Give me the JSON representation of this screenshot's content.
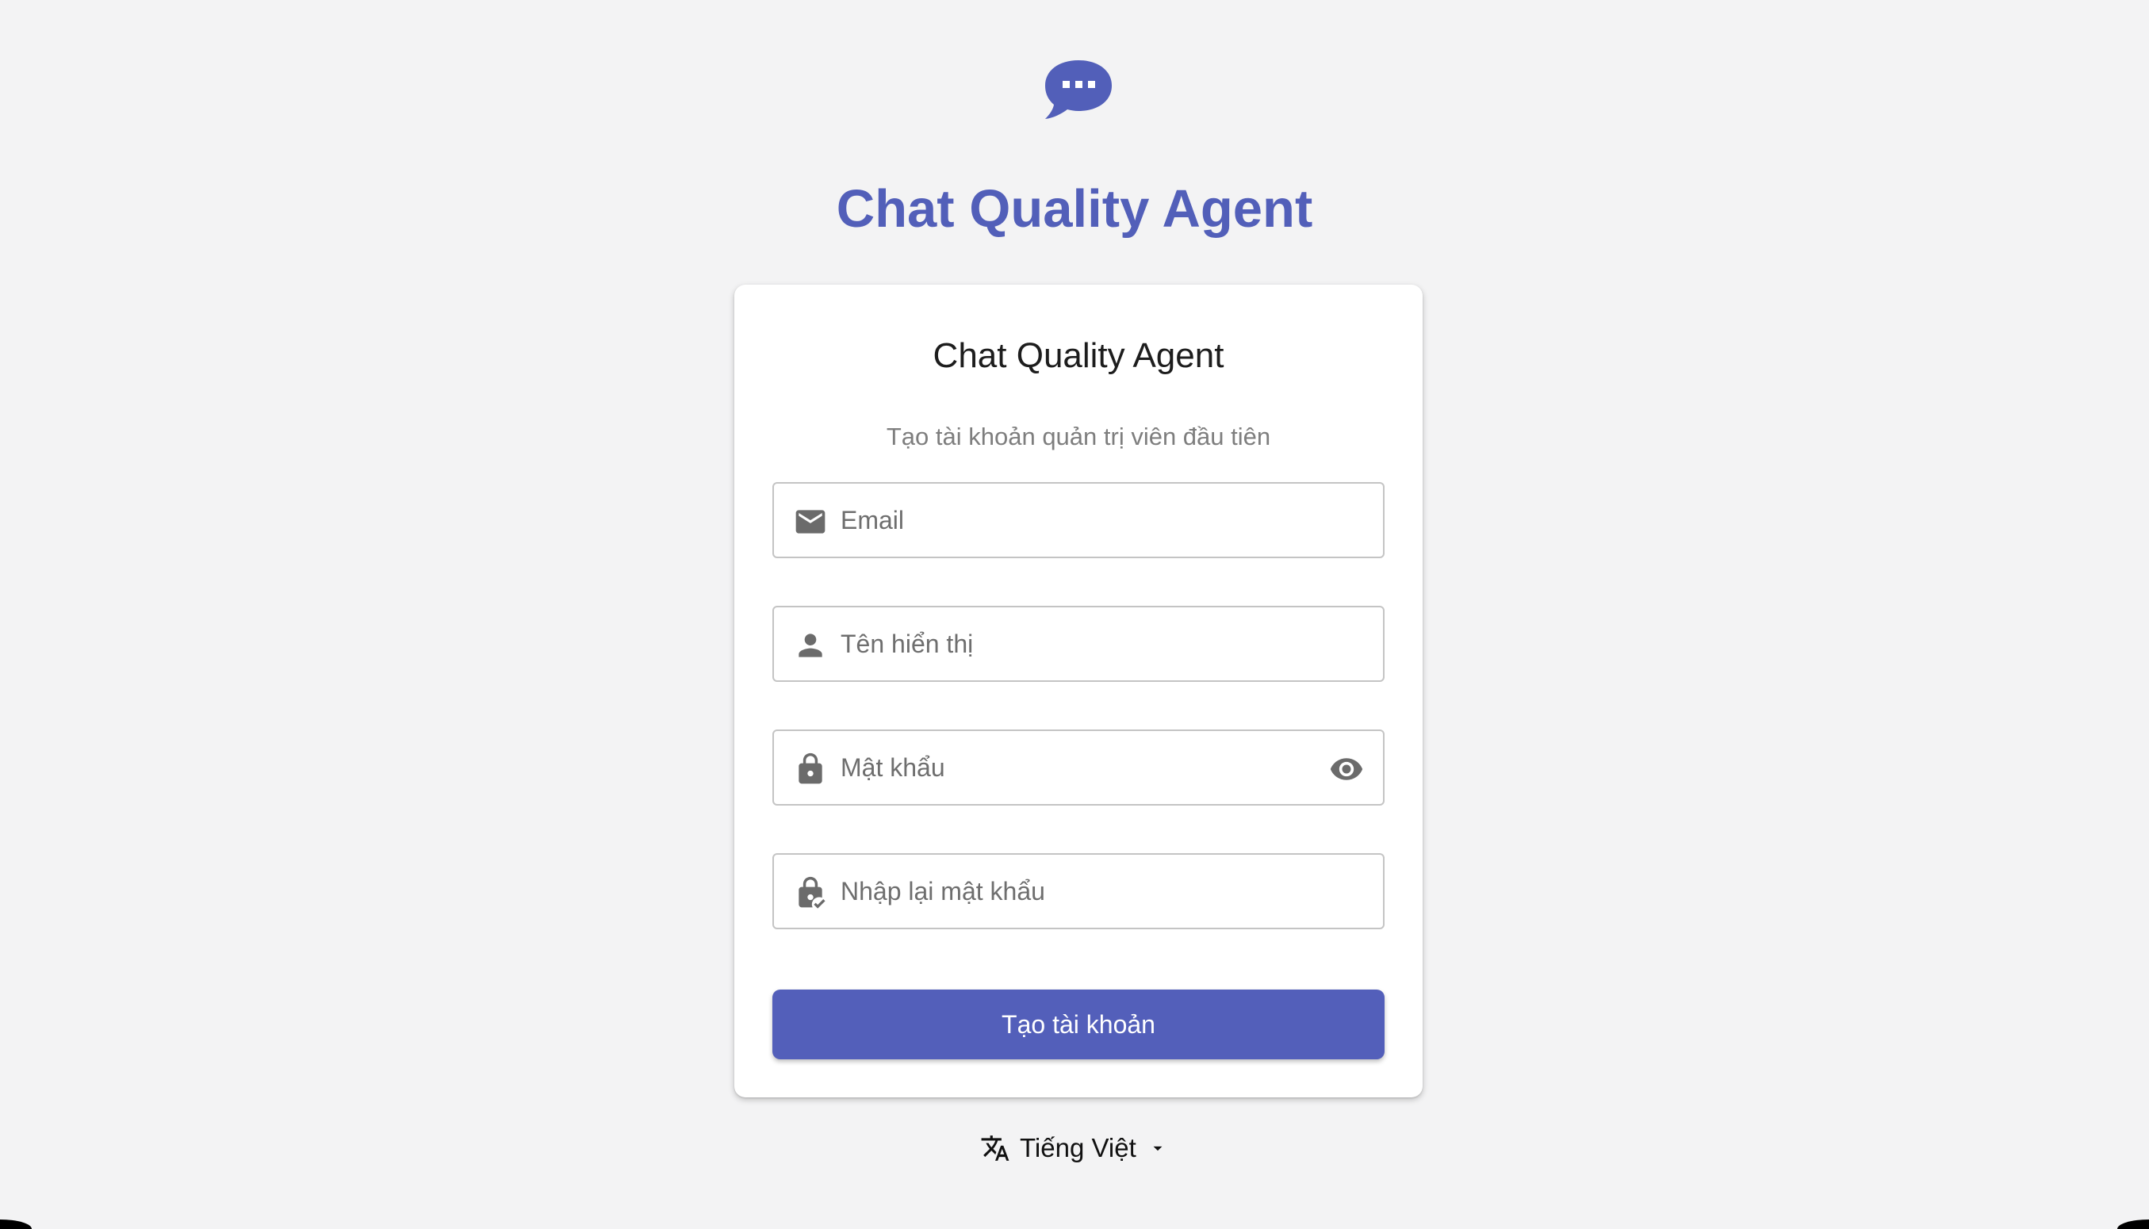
{
  "app": {
    "title": "Chat Quality Agent",
    "logo_icon": "chat-bubble-icon",
    "accent_color": "#525fb9"
  },
  "card": {
    "title": "Chat Quality Agent",
    "subtitle": "Tạo tài khoản quản trị viên đầu tiên",
    "fields": {
      "email": {
        "placeholder": "Email",
        "value": "",
        "icon": "envelope-icon"
      },
      "display_name": {
        "placeholder": "Tên hiển thị",
        "value": "",
        "icon": "person-icon"
      },
      "password": {
        "placeholder": "Mật khẩu",
        "value": "",
        "icon": "lock-icon",
        "toggle_icon": "eye-icon"
      },
      "confirm_password": {
        "placeholder": "Nhập lại mật khẩu",
        "value": "",
        "icon": "lock-check-icon"
      }
    },
    "submit_label": "Tạo tài khoản"
  },
  "language": {
    "selected": "Tiếng Việt",
    "icon": "translate-icon",
    "caret_icon": "caret-down-icon"
  }
}
